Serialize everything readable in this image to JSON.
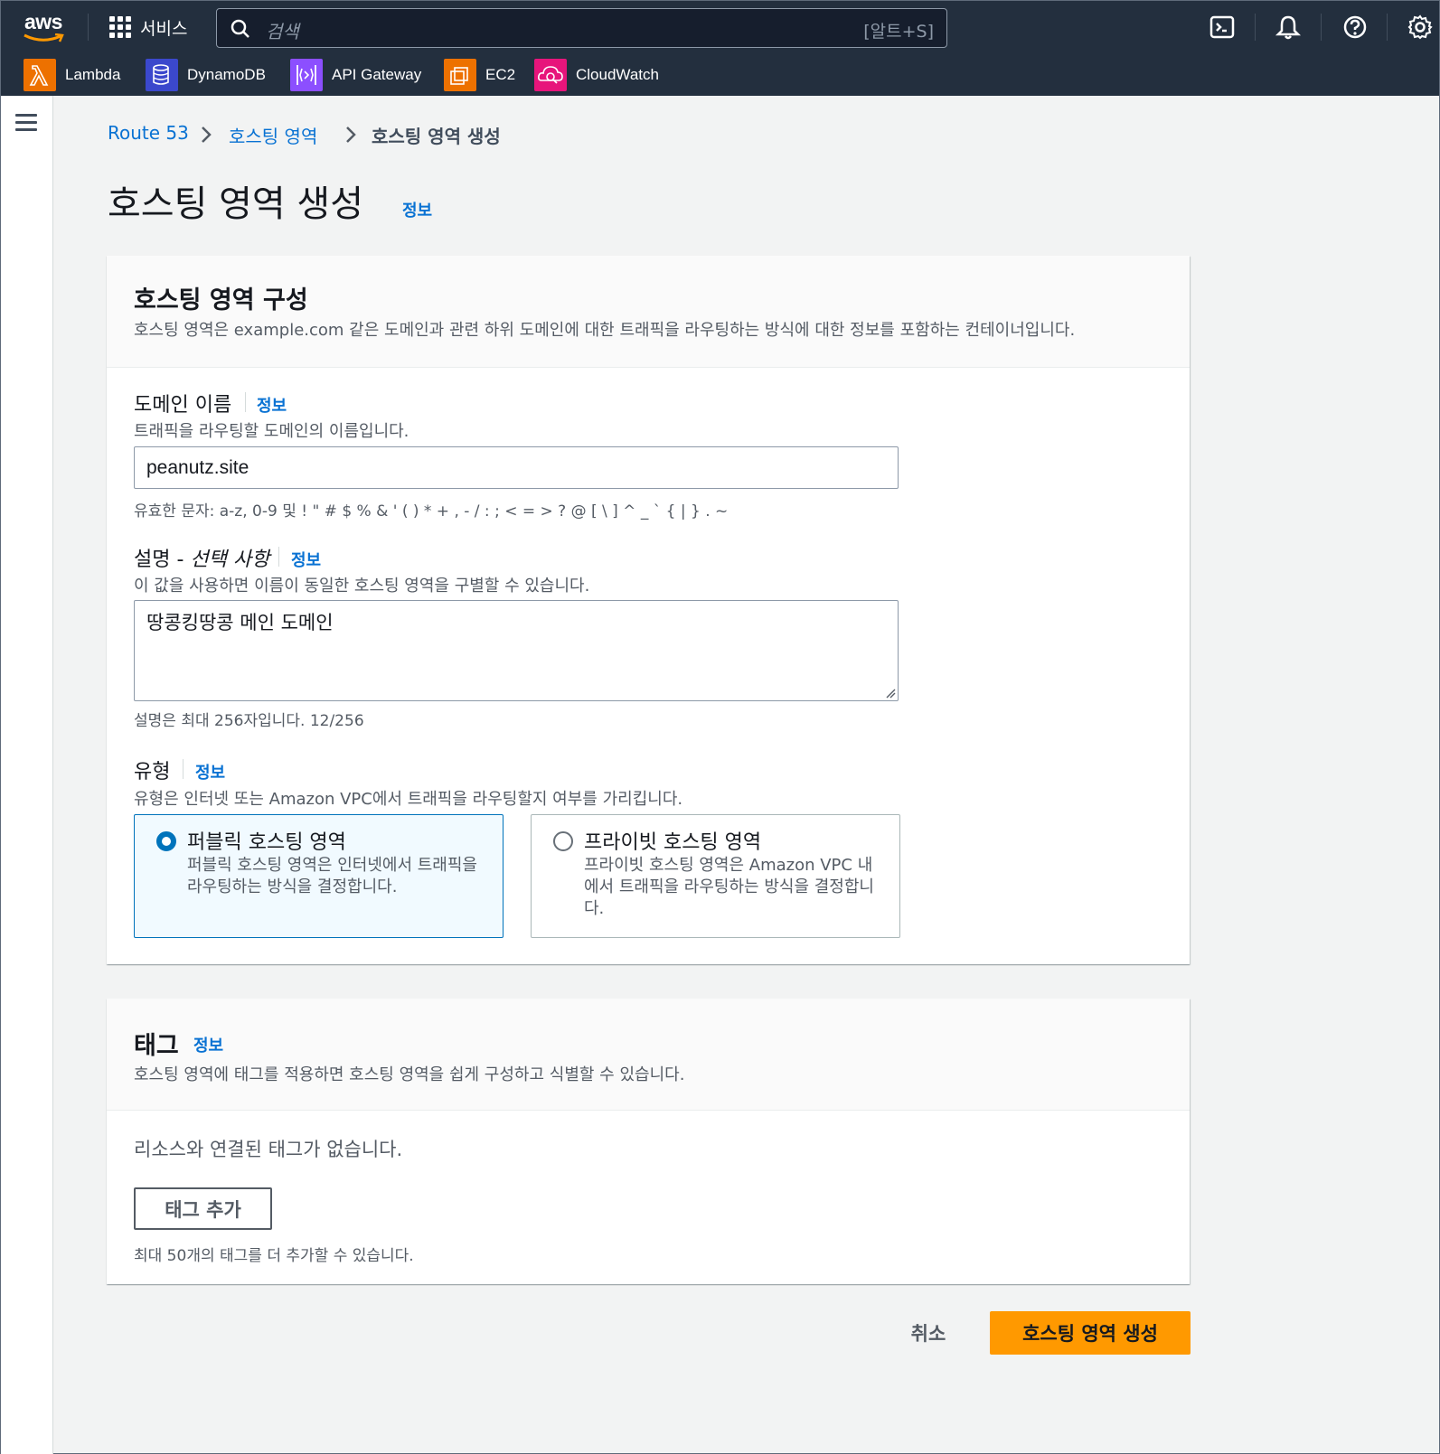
{
  "topnav": {
    "logo_text": "aws",
    "services_label": "서비스",
    "search": {
      "placeholder": "검색",
      "shortcut": "[알트+S]"
    },
    "icons": [
      "cloudshell-icon",
      "bell-icon",
      "help-icon",
      "settings-icon"
    ],
    "favorites": [
      {
        "label": "Lambda",
        "color": "#ed7100",
        "icon": "lambda-icon"
      },
      {
        "label": "DynamoDB",
        "color": "#3b48cc",
        "icon": "dynamodb-icon"
      },
      {
        "label": "API Gateway",
        "color": "#8c4fff",
        "icon": "api-gateway-icon"
      },
      {
        "label": "EC2",
        "color": "#ed7100",
        "icon": "ec2-icon"
      },
      {
        "label": "CloudWatch",
        "color": "#e7157b",
        "icon": "cloudwatch-icon"
      }
    ]
  },
  "breadcrumb": {
    "items": [
      "Route 53",
      "호스팅 영역",
      "호스팅 영역 생성"
    ]
  },
  "page": {
    "title": "호스팅 영역 생성",
    "info": "정보"
  },
  "config_panel": {
    "title": "호스팅 영역 구성",
    "description": "호스팅 영역은 example.com 같은 도메인과 관련 하위 도메인에 대한 트래픽을 라우팅하는 방식에 대한 정보를 포함하는 컨테이너입니다.",
    "domain": {
      "label": "도메인 이름",
      "info": "정보",
      "description": "트래픽을 라우팅할 도메인의 이름입니다.",
      "value": "peanutz.site",
      "hint": "유효한 문자: a-z, 0-9 및 ! \" # $ % & ' ( ) * + , - / : ; < = > ? @ [ \\ ] ^ _ ` { | } . ~"
    },
    "description_field": {
      "label_main": "설명 - ",
      "label_optional": "선택 사항",
      "info": "정보",
      "description": "이 값을 사용하면 이름이 동일한 호스팅 영역을 구별할 수 있습니다.",
      "value": "땅콩킹땅콩 메인 도메인",
      "hint": "설명은 최대 256자입니다. 12/256"
    },
    "type": {
      "label": "유형",
      "info": "정보",
      "description": "유형은 인터넷 또는 Amazon VPC에서 트래픽을 라우팅할지 여부를 가리킵니다.",
      "options": [
        {
          "title": "퍼블릭 호스팅 영역",
          "description": "퍼블릭 호스팅 영역은 인터넷에서 트래픽을 라우팅하는 방식을 결정합니다.",
          "selected": true
        },
        {
          "title": "프라이빗 호스팅 영역",
          "description": "프라이빗 호스팅 영역은 Amazon VPC 내에서 트래픽을 라우팅하는 방식을 결정합니다.",
          "selected": false
        }
      ]
    }
  },
  "tags_panel": {
    "title": "태그",
    "info": "정보",
    "description": "호스팅 영역에 태그를 적용하면 호스팅 영역을 쉽게 구성하고 식별할 수 있습니다.",
    "empty_text": "리소스와 연결된 태그가 없습니다.",
    "add_button": "태그 추가",
    "limit_text": "최대 50개의 태그를 더 추가할 수 있습니다."
  },
  "actions": {
    "cancel": "취소",
    "submit": "호스팅 영역 생성"
  }
}
